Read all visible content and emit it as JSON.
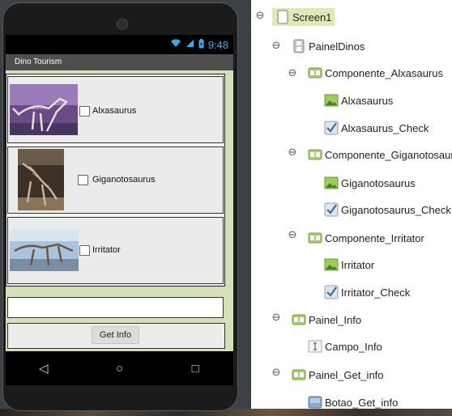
{
  "phone": {
    "status_time": "9:48",
    "app_title": "Dino Tourism",
    "dinos": [
      {
        "name": "Alxasaurus"
      },
      {
        "name": "Giganotosaurus"
      },
      {
        "name": "Irritator"
      }
    ],
    "campo_info_value": "",
    "get_info_label": "Get Info",
    "nav": {
      "back": "◁",
      "home": "○",
      "recents": "□"
    }
  },
  "tree": {
    "items": [
      {
        "label": "Screen1",
        "icon": "screen-icon"
      },
      {
        "label": "PainelDinos",
        "icon": "vertical-arrangement-icon"
      },
      {
        "label": "Componente_Alxasaurus",
        "icon": "horizontal-arrangement-icon"
      },
      {
        "label": "Alxasaurus",
        "icon": "image-icon"
      },
      {
        "label": "Alxasaurus_Check",
        "icon": "checkbox-icon"
      },
      {
        "label": "Componente_Giganotosaurus",
        "icon": "horizontal-arrangement-icon"
      },
      {
        "label": "Giganotosaurus",
        "icon": "image-icon"
      },
      {
        "label": "Giganotosaurus_Check",
        "icon": "checkbox-icon"
      },
      {
        "label": "Componente_Irritator",
        "icon": "horizontal-arrangement-icon"
      },
      {
        "label": "Irritator",
        "icon": "image-icon"
      },
      {
        "label": "Irritator_Check",
        "icon": "checkbox-icon"
      },
      {
        "label": "Painel_Info",
        "icon": "horizontal-arrangement-icon"
      },
      {
        "label": "Campo_Info",
        "icon": "textbox-icon"
      },
      {
        "label": "Painel_Get_info",
        "icon": "horizontal-arrangement-icon"
      },
      {
        "label": "Botao_Get_info",
        "icon": "button-icon"
      }
    ],
    "selected": "Screen1"
  },
  "colors": {
    "status_accent": "#2ab3f0",
    "app_background": "#d6e0b8",
    "tree_selection": "#dfe9b8"
  }
}
